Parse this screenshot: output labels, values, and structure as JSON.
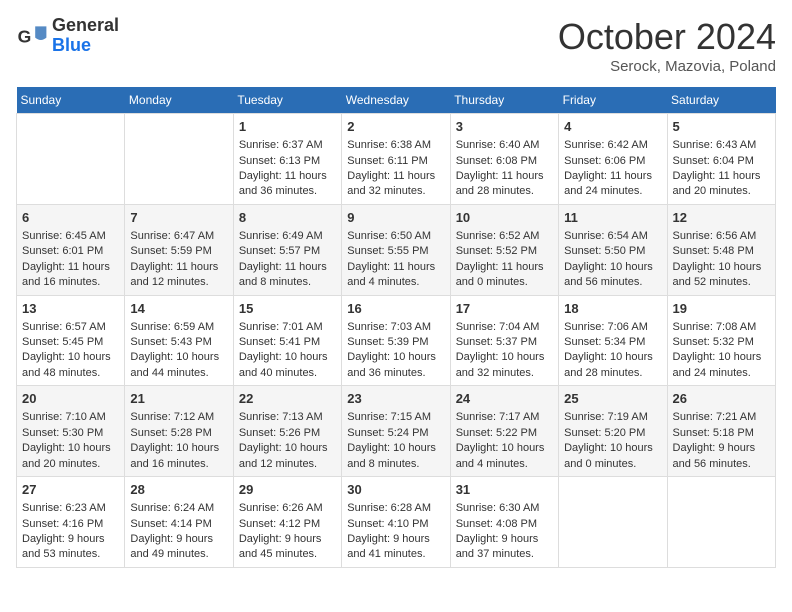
{
  "header": {
    "logo_general": "General",
    "logo_blue": "Blue",
    "month_title": "October 2024",
    "location": "Serock, Mazovia, Poland"
  },
  "days_of_week": [
    "Sunday",
    "Monday",
    "Tuesday",
    "Wednesday",
    "Thursday",
    "Friday",
    "Saturday"
  ],
  "weeks": [
    [
      {
        "day": "",
        "sunrise": "",
        "sunset": "",
        "daylight": ""
      },
      {
        "day": "",
        "sunrise": "",
        "sunset": "",
        "daylight": ""
      },
      {
        "day": "1",
        "sunrise": "Sunrise: 6:37 AM",
        "sunset": "Sunset: 6:13 PM",
        "daylight": "Daylight: 11 hours and 36 minutes."
      },
      {
        "day": "2",
        "sunrise": "Sunrise: 6:38 AM",
        "sunset": "Sunset: 6:11 PM",
        "daylight": "Daylight: 11 hours and 32 minutes."
      },
      {
        "day": "3",
        "sunrise": "Sunrise: 6:40 AM",
        "sunset": "Sunset: 6:08 PM",
        "daylight": "Daylight: 11 hours and 28 minutes."
      },
      {
        "day": "4",
        "sunrise": "Sunrise: 6:42 AM",
        "sunset": "Sunset: 6:06 PM",
        "daylight": "Daylight: 11 hours and 24 minutes."
      },
      {
        "day": "5",
        "sunrise": "Sunrise: 6:43 AM",
        "sunset": "Sunset: 6:04 PM",
        "daylight": "Daylight: 11 hours and 20 minutes."
      }
    ],
    [
      {
        "day": "6",
        "sunrise": "Sunrise: 6:45 AM",
        "sunset": "Sunset: 6:01 PM",
        "daylight": "Daylight: 11 hours and 16 minutes."
      },
      {
        "day": "7",
        "sunrise": "Sunrise: 6:47 AM",
        "sunset": "Sunset: 5:59 PM",
        "daylight": "Daylight: 11 hours and 12 minutes."
      },
      {
        "day": "8",
        "sunrise": "Sunrise: 6:49 AM",
        "sunset": "Sunset: 5:57 PM",
        "daylight": "Daylight: 11 hours and 8 minutes."
      },
      {
        "day": "9",
        "sunrise": "Sunrise: 6:50 AM",
        "sunset": "Sunset: 5:55 PM",
        "daylight": "Daylight: 11 hours and 4 minutes."
      },
      {
        "day": "10",
        "sunrise": "Sunrise: 6:52 AM",
        "sunset": "Sunset: 5:52 PM",
        "daylight": "Daylight: 11 hours and 0 minutes."
      },
      {
        "day": "11",
        "sunrise": "Sunrise: 6:54 AM",
        "sunset": "Sunset: 5:50 PM",
        "daylight": "Daylight: 10 hours and 56 minutes."
      },
      {
        "day": "12",
        "sunrise": "Sunrise: 6:56 AM",
        "sunset": "Sunset: 5:48 PM",
        "daylight": "Daylight: 10 hours and 52 minutes."
      }
    ],
    [
      {
        "day": "13",
        "sunrise": "Sunrise: 6:57 AM",
        "sunset": "Sunset: 5:45 PM",
        "daylight": "Daylight: 10 hours and 48 minutes."
      },
      {
        "day": "14",
        "sunrise": "Sunrise: 6:59 AM",
        "sunset": "Sunset: 5:43 PM",
        "daylight": "Daylight: 10 hours and 44 minutes."
      },
      {
        "day": "15",
        "sunrise": "Sunrise: 7:01 AM",
        "sunset": "Sunset: 5:41 PM",
        "daylight": "Daylight: 10 hours and 40 minutes."
      },
      {
        "day": "16",
        "sunrise": "Sunrise: 7:03 AM",
        "sunset": "Sunset: 5:39 PM",
        "daylight": "Daylight: 10 hours and 36 minutes."
      },
      {
        "day": "17",
        "sunrise": "Sunrise: 7:04 AM",
        "sunset": "Sunset: 5:37 PM",
        "daylight": "Daylight: 10 hours and 32 minutes."
      },
      {
        "day": "18",
        "sunrise": "Sunrise: 7:06 AM",
        "sunset": "Sunset: 5:34 PM",
        "daylight": "Daylight: 10 hours and 28 minutes."
      },
      {
        "day": "19",
        "sunrise": "Sunrise: 7:08 AM",
        "sunset": "Sunset: 5:32 PM",
        "daylight": "Daylight: 10 hours and 24 minutes."
      }
    ],
    [
      {
        "day": "20",
        "sunrise": "Sunrise: 7:10 AM",
        "sunset": "Sunset: 5:30 PM",
        "daylight": "Daylight: 10 hours and 20 minutes."
      },
      {
        "day": "21",
        "sunrise": "Sunrise: 7:12 AM",
        "sunset": "Sunset: 5:28 PM",
        "daylight": "Daylight: 10 hours and 16 minutes."
      },
      {
        "day": "22",
        "sunrise": "Sunrise: 7:13 AM",
        "sunset": "Sunset: 5:26 PM",
        "daylight": "Daylight: 10 hours and 12 minutes."
      },
      {
        "day": "23",
        "sunrise": "Sunrise: 7:15 AM",
        "sunset": "Sunset: 5:24 PM",
        "daylight": "Daylight: 10 hours and 8 minutes."
      },
      {
        "day": "24",
        "sunrise": "Sunrise: 7:17 AM",
        "sunset": "Sunset: 5:22 PM",
        "daylight": "Daylight: 10 hours and 4 minutes."
      },
      {
        "day": "25",
        "sunrise": "Sunrise: 7:19 AM",
        "sunset": "Sunset: 5:20 PM",
        "daylight": "Daylight: 10 hours and 0 minutes."
      },
      {
        "day": "26",
        "sunrise": "Sunrise: 7:21 AM",
        "sunset": "Sunset: 5:18 PM",
        "daylight": "Daylight: 9 hours and 56 minutes."
      }
    ],
    [
      {
        "day": "27",
        "sunrise": "Sunrise: 6:23 AM",
        "sunset": "Sunset: 4:16 PM",
        "daylight": "Daylight: 9 hours and 53 minutes."
      },
      {
        "day": "28",
        "sunrise": "Sunrise: 6:24 AM",
        "sunset": "Sunset: 4:14 PM",
        "daylight": "Daylight: 9 hours and 49 minutes."
      },
      {
        "day": "29",
        "sunrise": "Sunrise: 6:26 AM",
        "sunset": "Sunset: 4:12 PM",
        "daylight": "Daylight: 9 hours and 45 minutes."
      },
      {
        "day": "30",
        "sunrise": "Sunrise: 6:28 AM",
        "sunset": "Sunset: 4:10 PM",
        "daylight": "Daylight: 9 hours and 41 minutes."
      },
      {
        "day": "31",
        "sunrise": "Sunrise: 6:30 AM",
        "sunset": "Sunset: 4:08 PM",
        "daylight": "Daylight: 9 hours and 37 minutes."
      },
      {
        "day": "",
        "sunrise": "",
        "sunset": "",
        "daylight": ""
      },
      {
        "day": "",
        "sunrise": "",
        "sunset": "",
        "daylight": ""
      }
    ]
  ]
}
